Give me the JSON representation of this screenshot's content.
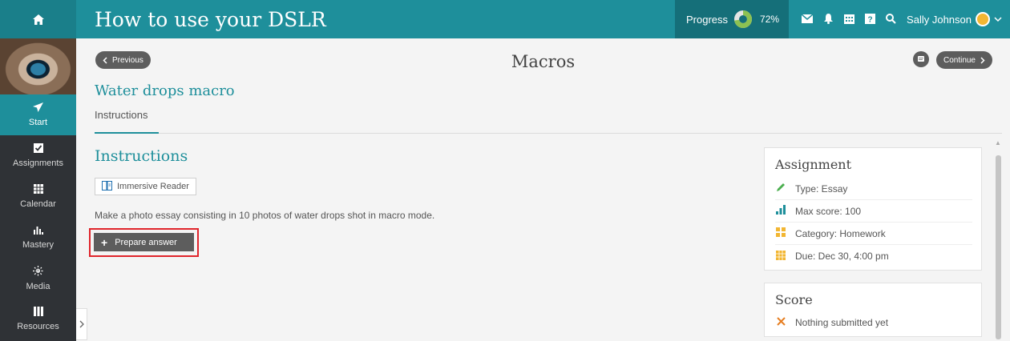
{
  "topbar": {
    "title": "How to use your DSLR",
    "progress_label": "Progress",
    "progress_value": "72%",
    "progress_fraction": 0.72,
    "user_name": "Sally Johnson",
    "icons": [
      "mail-icon",
      "bell-icon",
      "calendar-icon",
      "help-icon",
      "search-icon"
    ]
  },
  "sidebar": {
    "items": [
      {
        "label": "Start",
        "icon": "paper-plane-icon",
        "active": true
      },
      {
        "label": "Assignments",
        "icon": "checkbox-icon"
      },
      {
        "label": "Calendar",
        "icon": "calendar-icon"
      },
      {
        "label": "Mastery",
        "icon": "bar-chart-icon"
      },
      {
        "label": "Media",
        "icon": "sparkle-icon"
      },
      {
        "label": "Resources",
        "icon": "books-icon"
      }
    ]
  },
  "main": {
    "prev_label": "Previous",
    "continue_label": "Continue",
    "page_title": "Macros",
    "lesson_title": "Water drops macro",
    "tab_label": "Instructions",
    "section_title": "Instructions",
    "reader_label": "Immersive Reader",
    "description": "Make a photo essay consisting in 10 photos of water drops shot in macro mode.",
    "answer_label": "Prepare answer"
  },
  "assignment": {
    "title": "Assignment",
    "rows": [
      {
        "text": "Type: Essay",
        "icon": "pencil-icon",
        "color": "#4caf50"
      },
      {
        "text": "Max score: 100",
        "icon": "bar-chart-icon",
        "color": "#1e8f9b"
      },
      {
        "text": "Category: Homework",
        "icon": "category-icon",
        "color": "#f2b632"
      },
      {
        "text": "Due: Dec 30, 4:00 pm",
        "icon": "calendar-icon",
        "color": "#f2b632"
      }
    ]
  },
  "score": {
    "title": "Score",
    "status": "Nothing submitted yet",
    "status_color": "#e67e22"
  },
  "colors": {
    "accent": "#1e8f9b",
    "sidebar_bg": "#2f3236",
    "button_bg": "#5d5d5d",
    "highlight": "#e0242b"
  }
}
